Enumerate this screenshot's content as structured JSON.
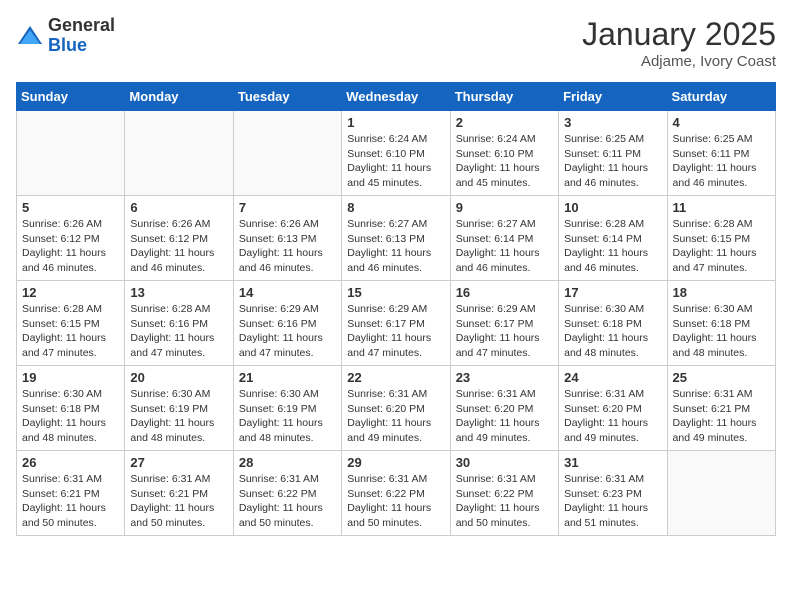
{
  "logo": {
    "general": "General",
    "blue": "Blue"
  },
  "header": {
    "month": "January 2025",
    "location": "Adjame, Ivory Coast"
  },
  "weekdays": [
    "Sunday",
    "Monday",
    "Tuesday",
    "Wednesday",
    "Thursday",
    "Friday",
    "Saturday"
  ],
  "weeks": [
    [
      {
        "day": "",
        "info": ""
      },
      {
        "day": "",
        "info": ""
      },
      {
        "day": "",
        "info": ""
      },
      {
        "day": "1",
        "info": "Sunrise: 6:24 AM\nSunset: 6:10 PM\nDaylight: 11 hours and 45 minutes."
      },
      {
        "day": "2",
        "info": "Sunrise: 6:24 AM\nSunset: 6:10 PM\nDaylight: 11 hours and 45 minutes."
      },
      {
        "day": "3",
        "info": "Sunrise: 6:25 AM\nSunset: 6:11 PM\nDaylight: 11 hours and 46 minutes."
      },
      {
        "day": "4",
        "info": "Sunrise: 6:25 AM\nSunset: 6:11 PM\nDaylight: 11 hours and 46 minutes."
      }
    ],
    [
      {
        "day": "5",
        "info": "Sunrise: 6:26 AM\nSunset: 6:12 PM\nDaylight: 11 hours and 46 minutes."
      },
      {
        "day": "6",
        "info": "Sunrise: 6:26 AM\nSunset: 6:12 PM\nDaylight: 11 hours and 46 minutes."
      },
      {
        "day": "7",
        "info": "Sunrise: 6:26 AM\nSunset: 6:13 PM\nDaylight: 11 hours and 46 minutes."
      },
      {
        "day": "8",
        "info": "Sunrise: 6:27 AM\nSunset: 6:13 PM\nDaylight: 11 hours and 46 minutes."
      },
      {
        "day": "9",
        "info": "Sunrise: 6:27 AM\nSunset: 6:14 PM\nDaylight: 11 hours and 46 minutes."
      },
      {
        "day": "10",
        "info": "Sunrise: 6:28 AM\nSunset: 6:14 PM\nDaylight: 11 hours and 46 minutes."
      },
      {
        "day": "11",
        "info": "Sunrise: 6:28 AM\nSunset: 6:15 PM\nDaylight: 11 hours and 47 minutes."
      }
    ],
    [
      {
        "day": "12",
        "info": "Sunrise: 6:28 AM\nSunset: 6:15 PM\nDaylight: 11 hours and 47 minutes."
      },
      {
        "day": "13",
        "info": "Sunrise: 6:28 AM\nSunset: 6:16 PM\nDaylight: 11 hours and 47 minutes."
      },
      {
        "day": "14",
        "info": "Sunrise: 6:29 AM\nSunset: 6:16 PM\nDaylight: 11 hours and 47 minutes."
      },
      {
        "day": "15",
        "info": "Sunrise: 6:29 AM\nSunset: 6:17 PM\nDaylight: 11 hours and 47 minutes."
      },
      {
        "day": "16",
        "info": "Sunrise: 6:29 AM\nSunset: 6:17 PM\nDaylight: 11 hours and 47 minutes."
      },
      {
        "day": "17",
        "info": "Sunrise: 6:30 AM\nSunset: 6:18 PM\nDaylight: 11 hours and 48 minutes."
      },
      {
        "day": "18",
        "info": "Sunrise: 6:30 AM\nSunset: 6:18 PM\nDaylight: 11 hours and 48 minutes."
      }
    ],
    [
      {
        "day": "19",
        "info": "Sunrise: 6:30 AM\nSunset: 6:18 PM\nDaylight: 11 hours and 48 minutes."
      },
      {
        "day": "20",
        "info": "Sunrise: 6:30 AM\nSunset: 6:19 PM\nDaylight: 11 hours and 48 minutes."
      },
      {
        "day": "21",
        "info": "Sunrise: 6:30 AM\nSunset: 6:19 PM\nDaylight: 11 hours and 48 minutes."
      },
      {
        "day": "22",
        "info": "Sunrise: 6:31 AM\nSunset: 6:20 PM\nDaylight: 11 hours and 49 minutes."
      },
      {
        "day": "23",
        "info": "Sunrise: 6:31 AM\nSunset: 6:20 PM\nDaylight: 11 hours and 49 minutes."
      },
      {
        "day": "24",
        "info": "Sunrise: 6:31 AM\nSunset: 6:20 PM\nDaylight: 11 hours and 49 minutes."
      },
      {
        "day": "25",
        "info": "Sunrise: 6:31 AM\nSunset: 6:21 PM\nDaylight: 11 hours and 49 minutes."
      }
    ],
    [
      {
        "day": "26",
        "info": "Sunrise: 6:31 AM\nSunset: 6:21 PM\nDaylight: 11 hours and 50 minutes."
      },
      {
        "day": "27",
        "info": "Sunrise: 6:31 AM\nSunset: 6:21 PM\nDaylight: 11 hours and 50 minutes."
      },
      {
        "day": "28",
        "info": "Sunrise: 6:31 AM\nSunset: 6:22 PM\nDaylight: 11 hours and 50 minutes."
      },
      {
        "day": "29",
        "info": "Sunrise: 6:31 AM\nSunset: 6:22 PM\nDaylight: 11 hours and 50 minutes."
      },
      {
        "day": "30",
        "info": "Sunrise: 6:31 AM\nSunset: 6:22 PM\nDaylight: 11 hours and 50 minutes."
      },
      {
        "day": "31",
        "info": "Sunrise: 6:31 AM\nSunset: 6:23 PM\nDaylight: 11 hours and 51 minutes."
      },
      {
        "day": "",
        "info": ""
      }
    ]
  ]
}
